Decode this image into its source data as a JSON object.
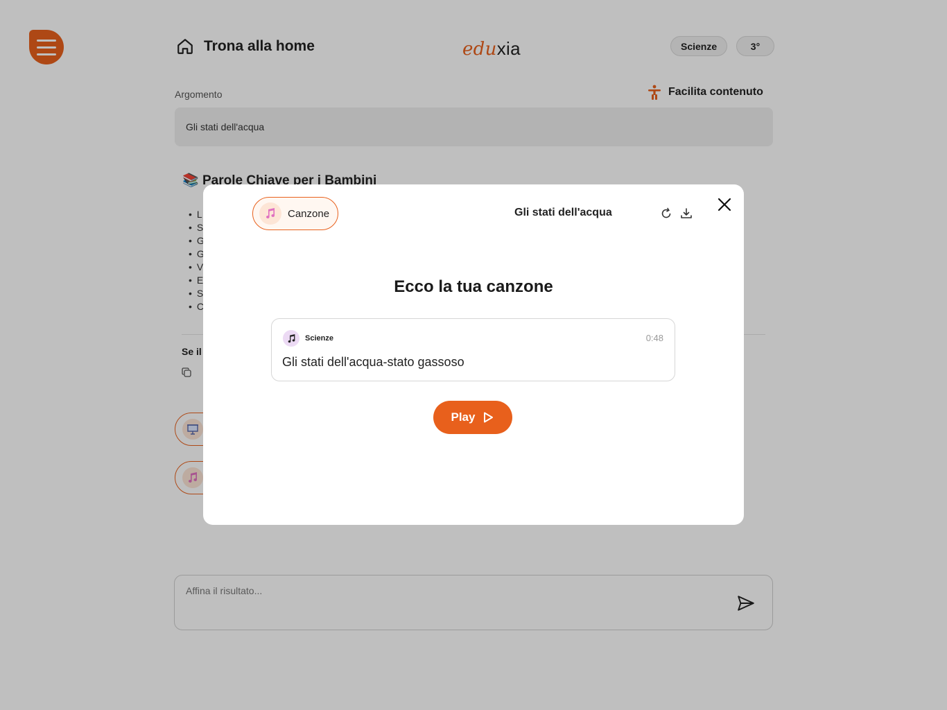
{
  "header": {
    "home_label": "Trona alla home",
    "logo_part1": "edu",
    "logo_part2": "xia",
    "subject_chip": "Scienze",
    "grade_chip": "3°"
  },
  "argument": {
    "label": "Argomento",
    "value": "Gli stati dell'acqua",
    "facilita_label": "Facilita contenuto"
  },
  "content": {
    "keywords_emoji": "📚",
    "keywords_title": "Parole Chiave per i Bambini",
    "keyword_initials": [
      "L",
      "S",
      "G",
      "G",
      "V",
      "E",
      "S",
      "C"
    ],
    "se_il": "Se il"
  },
  "refine": {
    "placeholder": "Affina il risultato..."
  },
  "modal": {
    "type_label": "Canzone",
    "topic": "Gli stati dell'acqua",
    "heading": "Ecco la tua canzone",
    "song": {
      "subject": "Scienze",
      "duration": "0:48",
      "title": "Gli stati dell'acqua-stato gassoso"
    },
    "play_label": "Play"
  },
  "colors": {
    "accent": "#e8601c",
    "accent_soft": "#fde5d6",
    "music_soft": "#ecdaf4"
  }
}
